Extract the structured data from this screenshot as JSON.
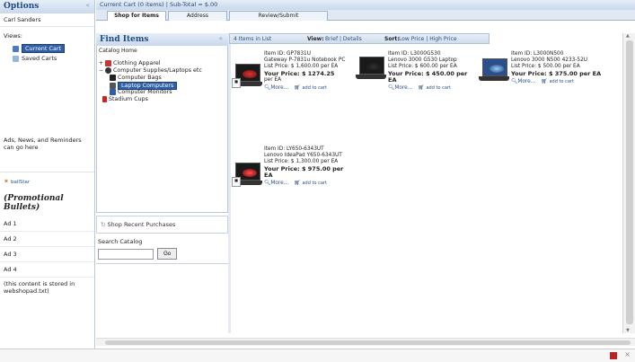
{
  "options": {
    "title": "Options",
    "collapse": "«",
    "user": "Carl Sanders",
    "views_label": "Views:",
    "views": [
      {
        "label": "Current Cart",
        "icon": "cart-icon",
        "selected": true
      },
      {
        "label": "Saved Carts",
        "icon": "saved-carts-icon",
        "selected": false
      }
    ],
    "ads_label": "Ads, News, and Reminders can go here",
    "link_label": "ballStar",
    "promo_text": "(Promotional Bullets)",
    "ads": [
      "Ad 1",
      "Ad 2",
      "Ad 3",
      "Ad 4"
    ],
    "stored_note": "(this content is stored in webshopad.txt)"
  },
  "header": {
    "cart_summary": "Current Cart (0 items) | Sub-Total = $.00",
    "tabs": [
      "Shop for Items",
      "Address",
      "Review/Submit"
    ]
  },
  "find": {
    "title": "Find Items",
    "collapse": "«",
    "catalog_home": "Catalog Home",
    "categories": [
      {
        "label": "Clothing Apparel",
        "expander": "+"
      },
      {
        "label": "Computer Supplies/Laptops etc",
        "expander": "−"
      },
      {
        "label": "Computer Bags"
      },
      {
        "label": "Laptop Computers"
      },
      {
        "label": "Computer Monitors"
      },
      {
        "label": "Stadium Cups"
      }
    ],
    "recent_label": "Shop Recent Purchases",
    "search_label": "Search Catalog",
    "search_value": "",
    "go_label": "Go"
  },
  "listing": {
    "count_text": "4 Items in List",
    "view_label": "View:",
    "view_options": "Brief | Details",
    "sort_label": "Sort:",
    "sort_options": "Low Price | High Price",
    "products": [
      {
        "item": "Item ID: GP7831U",
        "name": "Gateway P-7831u Notebook PC",
        "list_price": "List Price: $ 1,600.00 per EA",
        "your_price": "Your Price: $ 1274.25",
        "unit": "per EA",
        "more": "More...",
        "add": "add to cart"
      },
      {
        "item": "Item ID: L3000G530",
        "name": "Lenovo 3000 G530 Laptop",
        "list_price": "List Price: $ 600.00 per EA",
        "your_price": "Your Price: $ 450.00 per EA",
        "unit": "",
        "more": "More...",
        "add": "add to cart"
      },
      {
        "item": "Item ID: L3000N500",
        "name": "Lenovo 3000 N500 4233-52U",
        "list_price": "List Price: $ 500.00 per EA",
        "your_price": "Your Price: $ 375.00 per EA",
        "unit": "",
        "more": "More...",
        "add": "add to cart"
      },
      {
        "item": "Item ID: LY650-6343UT",
        "name": "Lenovo IdeaPad Y650-6343UT",
        "list_price": "List Price: $ 1,300.00 per EA",
        "your_price": "Your Price: $ 975.00 per EA",
        "unit": "",
        "more": "More...",
        "add": "add to cart"
      }
    ]
  },
  "colors": {
    "header_text": "#1f4a82",
    "selection": "#2f5fa6",
    "link": "#2a4f8a"
  }
}
